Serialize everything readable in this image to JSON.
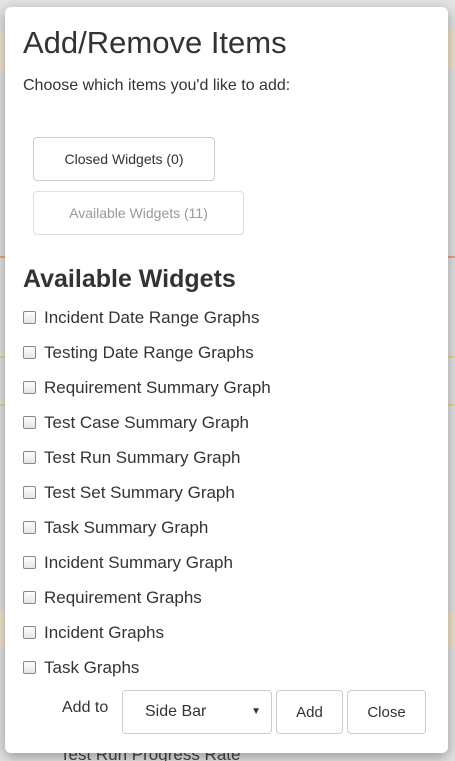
{
  "background": {
    "peek_text": "Test Run Progress Rate"
  },
  "modal": {
    "title": "Add/Remove Items",
    "subtitle": "Choose which items you'd like to add:",
    "closed_widgets_button": "Closed Widgets (0)",
    "available_widgets_button": "Available Widgets (11)",
    "section_title": "Available Widgets",
    "widgets": [
      {
        "label": "Incident Date Range Graphs",
        "checked": false
      },
      {
        "label": "Testing Date Range Graphs",
        "checked": false
      },
      {
        "label": "Requirement Summary Graph",
        "checked": false
      },
      {
        "label": "Test Case Summary Graph",
        "checked": false
      },
      {
        "label": "Test Run Summary Graph",
        "checked": false
      },
      {
        "label": "Test Set Summary Graph",
        "checked": false
      },
      {
        "label": "Task Summary Graph",
        "checked": false
      },
      {
        "label": "Incident Summary Graph",
        "checked": false
      },
      {
        "label": "Requirement Graphs",
        "checked": false
      },
      {
        "label": "Incident Graphs",
        "checked": false
      },
      {
        "label": "Task Graphs",
        "checked": false
      }
    ],
    "footer": {
      "add_to_label": "Add to",
      "select_value": "Side Bar",
      "add_button": "Add",
      "close_button": "Close"
    }
  },
  "colors": {
    "modal_bg": "#ffffff",
    "overlay_bg": "#e4e4e4",
    "border": "#cccccc",
    "text": "#333333",
    "muted_text": "#999999"
  }
}
